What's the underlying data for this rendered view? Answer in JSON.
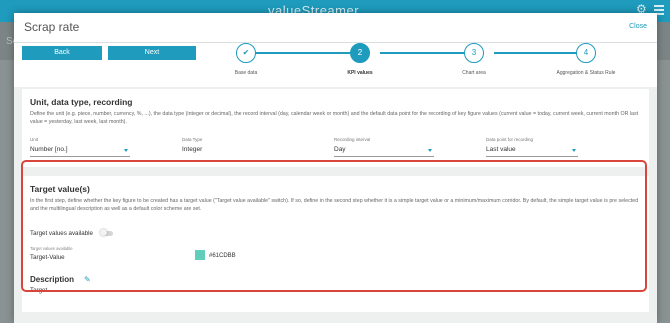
{
  "app": {
    "logo": "valueStreamer"
  },
  "background": {
    "side_text": "Sc"
  },
  "modal": {
    "title": "Scrap rate",
    "close_label": "Close",
    "buttons": {
      "back": "Back",
      "next": "Next"
    },
    "steps": [
      {
        "number": "1",
        "label": "Base data",
        "state": "done"
      },
      {
        "number": "2",
        "label": "KPI values",
        "state": "active"
      },
      {
        "number": "3",
        "label": "Chart area",
        "state": "pending"
      },
      {
        "number": "4",
        "label": "Aggregation & Status Rule",
        "state": "pending"
      }
    ]
  },
  "unit_section": {
    "title": "Unit, data type, recording",
    "description": "Define the unit (e.g. piece, number, currency, %, ...), the data type (integer or decimal), the record interval (day, calendar week or month) and the default data point for the recording of key figure values (current value = today, current week, current month OR last value = yesterday, last week, last month).",
    "fields": [
      {
        "label": "Unit",
        "value": "Number [no.]",
        "dropdown": true
      },
      {
        "label": "Data Type",
        "value": "Integer",
        "dropdown": false
      },
      {
        "label": "Recording interval",
        "value": "Day",
        "dropdown": true
      },
      {
        "label": "Data point for recording",
        "value": "Last value",
        "dropdown": true
      }
    ]
  },
  "target_section": {
    "title": "Target value(s)",
    "description": "In the first step, define whether the key figure to be created has a target value (\"Target value available\" switch). If so, define in the second step whether it is a simple target value or a minimum/maximum corridor. By default, the simple target value is pre selected and the multilingual description as well as a default color scheme are set.",
    "toggle_label": "Target values available",
    "toggle_on": false,
    "small_label": "Target values available",
    "target_value_label": "Target-Value",
    "color_hex": "#61CDBB",
    "description_heading": "Description",
    "description_value": "Target"
  },
  "colors": {
    "accent": "#1e9bbd",
    "highlight": "#d9453b",
    "swatch": "#61CDBB"
  }
}
